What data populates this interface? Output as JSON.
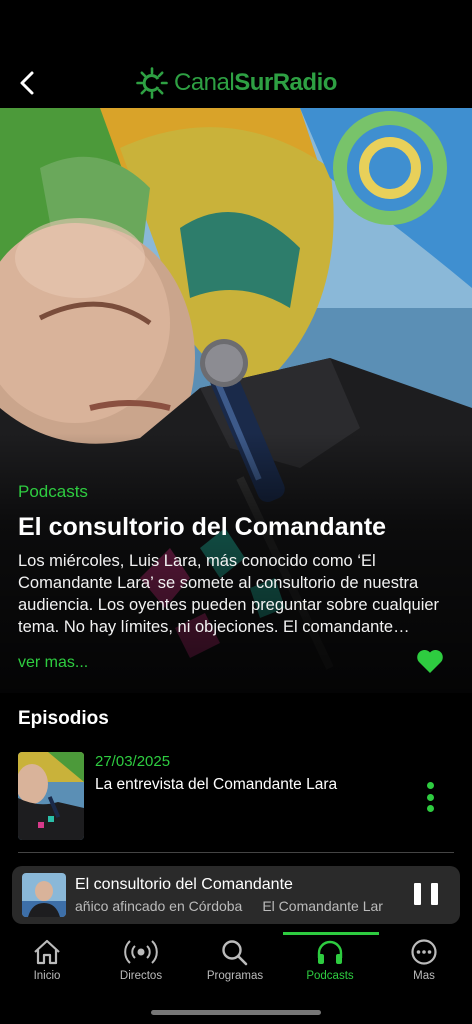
{
  "header": {
    "back_icon": "chevron-left-icon",
    "logo_part1": "Canal",
    "logo_part2": "SurRadio",
    "logo_icon": "sun-icon",
    "brand_color": "#2ea043"
  },
  "hero": {
    "category": "Podcasts",
    "title": "El consultorio del Comandante",
    "description": "Los miércoles, Luis Lara, más conocido como ‘El Comandante Lara’ se somete al consultorio de nuestra audiencia. Los oyentes pueden preguntar sobre cualquier tema. No hay límites, ni objeciones. El comandante responde a todo.",
    "more_label": "ver mas...",
    "favorite_icon": "heart-icon",
    "accent_color": "#2ecc40"
  },
  "episodes": {
    "section_title": "Episodios",
    "items": [
      {
        "date": "27/03/2025",
        "title": "La entrevista del Comandante Lara",
        "menu_icon": "vertical-dots-icon"
      }
    ]
  },
  "player": {
    "title": "El consultorio del Comandante",
    "subtitle_a": "añico afincado en Córdoba",
    "subtitle_b": "El Comandante Lar",
    "pause_icon": "pause-icon"
  },
  "tabs": [
    {
      "label": "Inicio",
      "icon": "home-icon"
    },
    {
      "label": "Directos",
      "icon": "broadcast-icon"
    },
    {
      "label": "Programas",
      "icon": "search-icon"
    },
    {
      "label": "Podcasts",
      "icon": "headphones-icon",
      "active": true
    },
    {
      "label": "Mas",
      "icon": "more-dots-icon"
    }
  ]
}
